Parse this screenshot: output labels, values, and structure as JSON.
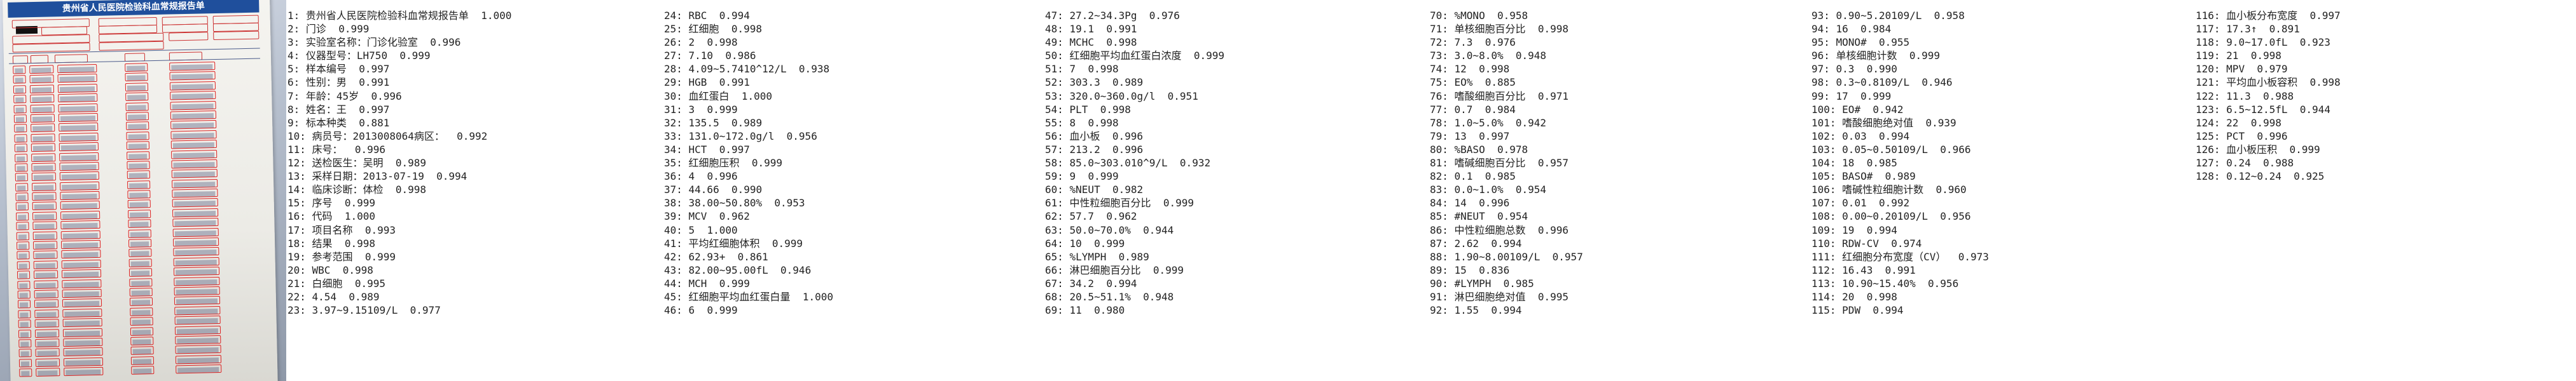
{
  "entries": [
    {
      "n": "1",
      "text": "贵州省人民医院检验科血常规报告单",
      "score": "1.000"
    },
    {
      "n": "2",
      "text": "门诊",
      "score": "0.999"
    },
    {
      "n": "3",
      "text": "实验室名称：门诊化验室",
      "score": "0.996"
    },
    {
      "n": "4",
      "text": "仪器型号：LH750",
      "score": "0.999"
    },
    {
      "n": "5",
      "text": "样本编号",
      "score": "0.997"
    },
    {
      "n": "6",
      "text": "性别：男",
      "score": "0.991"
    },
    {
      "n": "7",
      "text": "年龄：45岁",
      "score": "0.996"
    },
    {
      "n": "8",
      "text": "姓名：王",
      "score": "0.997"
    },
    {
      "n": "9",
      "text": "标本种类",
      "score": "0.881"
    },
    {
      "n": "10",
      "text": "病员号：2013008064病区：",
      "score": "0.992"
    },
    {
      "n": "11",
      "text": "床号：",
      "score": "0.996"
    },
    {
      "n": "12",
      "text": "送检医生：吴明",
      "score": "0.989"
    },
    {
      "n": "13",
      "text": "采样日期：2013-07-19",
      "score": "0.994"
    },
    {
      "n": "14",
      "text": "临床诊断：体检",
      "score": "0.998"
    },
    {
      "n": "15",
      "text": "序号",
      "score": "0.999"
    },
    {
      "n": "16",
      "text": "代码",
      "score": "1.000"
    },
    {
      "n": "17",
      "text": "项目名称",
      "score": "0.993"
    },
    {
      "n": "18",
      "text": "结果",
      "score": "0.998"
    },
    {
      "n": "19",
      "text": "参考范围",
      "score": "0.999"
    },
    {
      "n": "20",
      "text": "WBC",
      "score": "0.998"
    },
    {
      "n": "21",
      "text": "白细胞",
      "score": "0.995"
    },
    {
      "n": "22",
      "text": "4.54",
      "score": "0.989"
    },
    {
      "n": "23",
      "text": "3.97~9.15109/L",
      "score": "0.977"
    },
    {
      "n": "24",
      "text": "RBC",
      "score": "0.994"
    },
    {
      "n": "25",
      "text": "红细胞",
      "score": "0.998"
    },
    {
      "n": "26",
      "text": "2",
      "score": "0.998"
    },
    {
      "n": "27",
      "text": "7.10",
      "score": "0.986"
    },
    {
      "n": "28",
      "text": "4.09~5.7410^12/L",
      "score": "0.938"
    },
    {
      "n": "29",
      "text": "HGB",
      "score": "0.991"
    },
    {
      "n": "30",
      "text": "血红蛋白",
      "score": "1.000"
    },
    {
      "n": "31",
      "text": "3",
      "score": "0.999"
    },
    {
      "n": "32",
      "text": "135.5",
      "score": "0.989"
    },
    {
      "n": "33",
      "text": "131.0~172.0g/l",
      "score": "0.956"
    },
    {
      "n": "34",
      "text": "HCT",
      "score": "0.997"
    },
    {
      "n": "35",
      "text": "红细胞压积",
      "score": "0.999"
    },
    {
      "n": "36",
      "text": "4",
      "score": "0.996"
    },
    {
      "n": "37",
      "text": "44.66",
      "score": "0.990"
    },
    {
      "n": "38",
      "text": "38.00~50.80%",
      "score": "0.953"
    },
    {
      "n": "39",
      "text": "MCV",
      "score": "0.962"
    },
    {
      "n": "40",
      "text": "5",
      "score": "1.000"
    },
    {
      "n": "41",
      "text": "平均红细胞体积",
      "score": "0.999"
    },
    {
      "n": "42",
      "text": "62.93+",
      "score": "0.861"
    },
    {
      "n": "43",
      "text": "82.00~95.00fL",
      "score": "0.946"
    },
    {
      "n": "44",
      "text": "MCH",
      "score": "0.999"
    },
    {
      "n": "45",
      "text": "红细胞平均血红蛋白量",
      "score": "1.000"
    },
    {
      "n": "46",
      "text": "6",
      "score": "0.999"
    },
    {
      "n": "47",
      "text": "27.2~34.3Pg",
      "score": "0.976"
    },
    {
      "n": "48",
      "text": "19.1",
      "score": "0.991"
    },
    {
      "n": "49",
      "text": "MCHC",
      "score": "0.998"
    },
    {
      "n": "50",
      "text": "红细胞平均血红蛋白浓度",
      "score": "0.999"
    },
    {
      "n": "51",
      "text": "7",
      "score": "0.998"
    },
    {
      "n": "52",
      "text": "303.3",
      "score": "0.989"
    },
    {
      "n": "53",
      "text": "320.0~360.0g/l",
      "score": "0.951"
    },
    {
      "n": "54",
      "text": "PLT",
      "score": "0.998"
    },
    {
      "n": "55",
      "text": "8",
      "score": "0.998"
    },
    {
      "n": "56",
      "text": "血小板",
      "score": "0.996"
    },
    {
      "n": "57",
      "text": "213.2",
      "score": "0.996"
    },
    {
      "n": "58",
      "text": "85.0~303.010^9/L",
      "score": "0.932"
    },
    {
      "n": "59",
      "text": "9",
      "score": "0.999"
    },
    {
      "n": "60",
      "text": "%NEUT",
      "score": "0.982"
    },
    {
      "n": "61",
      "text": "中性粒细胞百分比",
      "score": "0.999"
    },
    {
      "n": "62",
      "text": "57.7",
      "score": "0.962"
    },
    {
      "n": "63",
      "text": "50.0~70.0%",
      "score": "0.944"
    },
    {
      "n": "64",
      "text": "10",
      "score": "0.999"
    },
    {
      "n": "65",
      "text": "%LYMPH",
      "score": "0.989"
    },
    {
      "n": "66",
      "text": "淋巴细胞百分比",
      "score": "0.999"
    },
    {
      "n": "67",
      "text": "34.2",
      "score": "0.994"
    },
    {
      "n": "68",
      "text": "20.5~51.1%",
      "score": "0.948"
    },
    {
      "n": "69",
      "text": "11",
      "score": "0.980"
    },
    {
      "n": "70",
      "text": "%MONO",
      "score": "0.958"
    },
    {
      "n": "71",
      "text": "单核细胞百分比",
      "score": "0.998"
    },
    {
      "n": "72",
      "text": "7.3",
      "score": "0.976"
    },
    {
      "n": "73",
      "text": "3.0~8.0%",
      "score": "0.948"
    },
    {
      "n": "74",
      "text": "12",
      "score": "0.998"
    },
    {
      "n": "75",
      "text": "EO%",
      "score": "0.885"
    },
    {
      "n": "76",
      "text": "嗜酸细胞百分比",
      "score": "0.971"
    },
    {
      "n": "77",
      "text": "0.7",
      "score": "0.984"
    },
    {
      "n": "78",
      "text": "1.0~5.0%",
      "score": "0.942"
    },
    {
      "n": "79",
      "text": "13",
      "score": "0.997"
    },
    {
      "n": "80",
      "text": "%BASO",
      "score": "0.978"
    },
    {
      "n": "81",
      "text": "嗜碱细胞百分比",
      "score": "0.957"
    },
    {
      "n": "82",
      "text": "0.1",
      "score": "0.985"
    },
    {
      "n": "83",
      "text": "0.0~1.0%",
      "score": "0.954"
    },
    {
      "n": "84",
      "text": "14",
      "score": "0.996"
    },
    {
      "n": "85",
      "text": "#NEUT",
      "score": "0.954"
    },
    {
      "n": "86",
      "text": "中性粒细胞总数",
      "score": "0.996"
    },
    {
      "n": "87",
      "text": "2.62",
      "score": "0.994"
    },
    {
      "n": "88",
      "text": "1.90~8.00109/L",
      "score": "0.957"
    },
    {
      "n": "89",
      "text": "15",
      "score": "0.836"
    },
    {
      "n": "90",
      "text": "#LYMPH",
      "score": "0.985"
    },
    {
      "n": "91",
      "text": "淋巴细胞绝对值",
      "score": "0.995"
    },
    {
      "n": "92",
      "text": "1.55",
      "score": "0.994"
    },
    {
      "n": "93",
      "text": "0.90~5.20109/L",
      "score": "0.958"
    },
    {
      "n": "94",
      "text": "16",
      "score": "0.984"
    },
    {
      "n": "95",
      "text": "MONO#",
      "score": "0.955"
    },
    {
      "n": "96",
      "text": "单核细胞计数",
      "score": "0.999"
    },
    {
      "n": "97",
      "text": "0.3",
      "score": "0.990"
    },
    {
      "n": "98",
      "text": "0.3~0.8109/L",
      "score": "0.946"
    },
    {
      "n": "99",
      "text": "17",
      "score": "0.999"
    },
    {
      "n": "100",
      "text": "EO#",
      "score": "0.942"
    },
    {
      "n": "101",
      "text": "嗜酸细胞绝对值",
      "score": "0.939"
    },
    {
      "n": "102",
      "text": "0.03",
      "score": "0.994"
    },
    {
      "n": "103",
      "text": "0.05~0.50109/L",
      "score": "0.966"
    },
    {
      "n": "104",
      "text": "18",
      "score": "0.985"
    },
    {
      "n": "105",
      "text": "BASO#",
      "score": "0.989"
    },
    {
      "n": "106",
      "text": "嗜碱性粒细胞计数",
      "score": "0.960"
    },
    {
      "n": "107",
      "text": "0.01",
      "score": "0.992"
    },
    {
      "n": "108",
      "text": "0.00~0.20109/L",
      "score": "0.956"
    },
    {
      "n": "109",
      "text": "19",
      "score": "0.994"
    },
    {
      "n": "110",
      "text": "RDW-CV",
      "score": "0.974"
    },
    {
      "n": "111",
      "text": "红细胞分布宽度（CV）",
      "score": "0.973"
    },
    {
      "n": "112",
      "text": "16.43",
      "score": "0.991"
    },
    {
      "n": "113",
      "text": "10.90~15.40%",
      "score": "0.956"
    },
    {
      "n": "114",
      "text": "20",
      "score": "0.998"
    },
    {
      "n": "115",
      "text": "PDW",
      "score": "0.994"
    },
    {
      "n": "116",
      "text": "血小板分布宽度",
      "score": "0.997"
    },
    {
      "n": "117",
      "text": "17.3↑",
      "score": "0.891"
    },
    {
      "n": "118",
      "text": "9.0~17.0fL",
      "score": "0.923"
    },
    {
      "n": "119",
      "text": "21",
      "score": "0.998"
    },
    {
      "n": "120",
      "text": "MPV",
      "score": "0.979"
    },
    {
      "n": "121",
      "text": "平均血小板容积",
      "score": "0.998"
    },
    {
      "n": "122",
      "text": "11.3",
      "score": "0.988"
    },
    {
      "n": "123",
      "text": "6.5~12.5fL",
      "score": "0.944"
    },
    {
      "n": "124",
      "text": "22",
      "score": "0.998"
    },
    {
      "n": "125",
      "text": "PCT",
      "score": "0.996"
    },
    {
      "n": "126",
      "text": "血小板压积",
      "score": "0.999"
    },
    {
      "n": "127",
      "text": "0.24",
      "score": "0.988"
    },
    {
      "n": "128",
      "text": "0.12~0.24",
      "score": "0.925"
    }
  ],
  "photo": {
    "report_title": "贵州省人民医院检验科血常规报告单"
  }
}
